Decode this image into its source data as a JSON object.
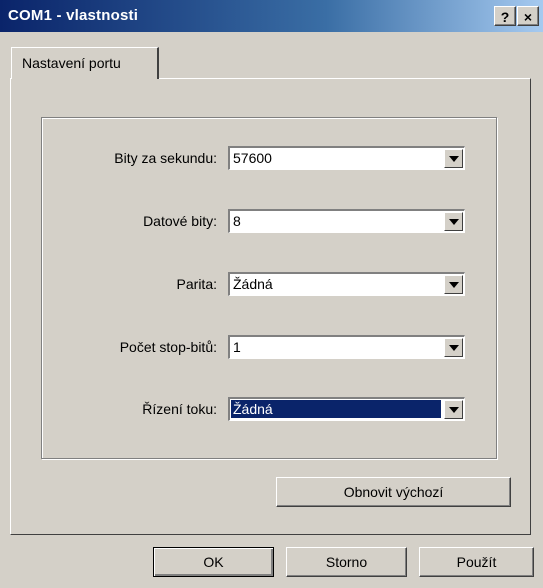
{
  "window": {
    "title": "COM1 - vlastnosti",
    "help_label": "?",
    "close_label": "×"
  },
  "tabs": [
    {
      "label": "Nastavení portu",
      "selected": true
    }
  ],
  "fields": [
    {
      "label": "Bity za sekundu:",
      "value": "57600"
    },
    {
      "label": "Datové bity:",
      "value": "8"
    },
    {
      "label": "Parita:",
      "value": "Žádná"
    },
    {
      "label": "Počet stop-bitů:",
      "value": "1"
    },
    {
      "label": "Řízení toku:",
      "value": "Žádná",
      "focused": true
    }
  ],
  "restore_button": "Obnovit výchozí",
  "footer": {
    "ok": "OK",
    "cancel": "Storno",
    "apply": "Použít"
  },
  "colors": {
    "face": "#d4d0c8",
    "title_start": "#0a246a",
    "title_end": "#a6caf0",
    "selection": "#0a246a"
  }
}
